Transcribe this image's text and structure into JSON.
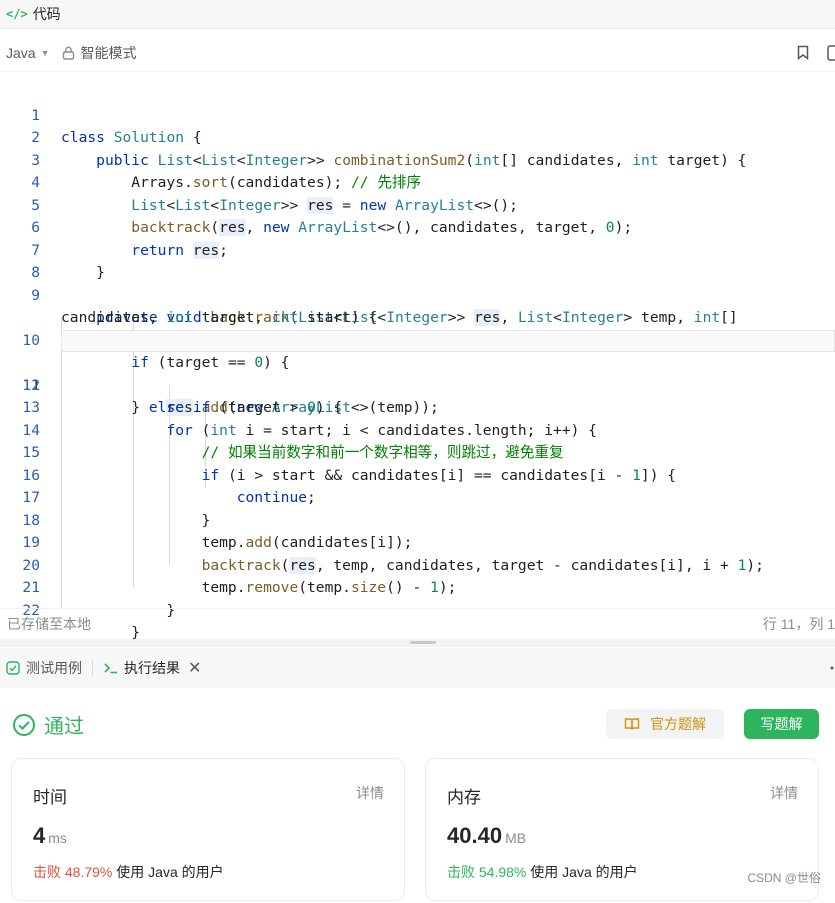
{
  "header": {
    "tab_title": "代码"
  },
  "toolbar": {
    "language": "Java",
    "mode": "智能模式"
  },
  "editor": {
    "active_line": 11,
    "lines": [
      {
        "no": "1"
      },
      {
        "no": "2"
      },
      {
        "no": "3"
      },
      {
        "no": "4"
      },
      {
        "no": "5"
      },
      {
        "no": "6"
      },
      {
        "no": "7"
      },
      {
        "no": "8"
      },
      {
        "no": "9"
      },
      {
        "no": "10"
      },
      {
        "no": "11"
      },
      {
        "no": "12"
      },
      {
        "no": "13"
      },
      {
        "no": "14"
      },
      {
        "no": "15"
      },
      {
        "no": "16"
      },
      {
        "no": "17"
      },
      {
        "no": "18"
      },
      {
        "no": "19"
      },
      {
        "no": "20"
      },
      {
        "no": "21"
      },
      {
        "no": "22"
      }
    ],
    "comments": {
      "sort": "// 先排序",
      "skip": "// 如果当前数字和前一个数字相等，则跳过，避免重复"
    }
  },
  "status": {
    "saved": "已存储至本地",
    "cursor": "行 11，列 1"
  },
  "panel": {
    "tab_testcase": "测试用例",
    "tab_result": "执行结果"
  },
  "result": {
    "status": "通过",
    "official_solution": "官方题解",
    "write_solution": "写题解",
    "time": {
      "label": "时间",
      "detail": "详情",
      "value": "4",
      "unit": "ms",
      "beat_prefix": "击败",
      "beat": "48.79%",
      "beat_suffix": "使用 Java 的用户"
    },
    "memory": {
      "label": "内存",
      "detail": "详情",
      "value": "40.40",
      "unit": "MB",
      "beat_prefix": "击败",
      "beat": "54.98%",
      "beat_suffix": "使用 Java 的用户"
    },
    "watermark": "CSDN @世俗"
  },
  "colors": {
    "accent": "#2db55d",
    "beat_time": "#e0533f",
    "official": "#d4910b"
  }
}
